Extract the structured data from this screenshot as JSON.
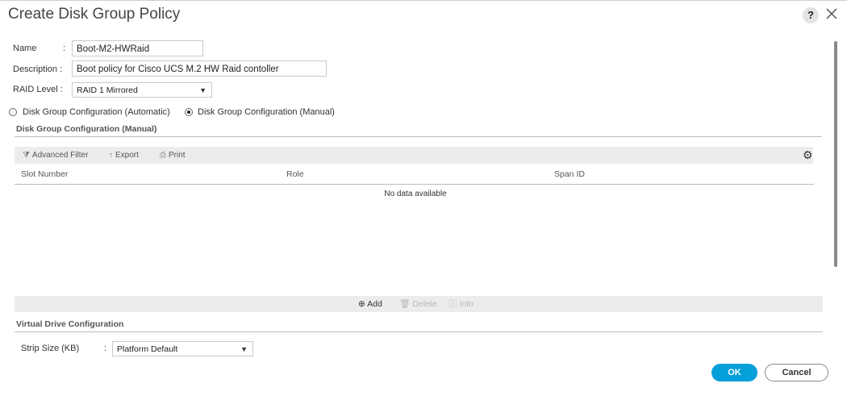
{
  "dialog": {
    "title": "Create Disk Group Policy",
    "help_glyph": "?"
  },
  "form": {
    "name_label": "Name",
    "name_colon": ":",
    "name_value": "Boot-M2-HWRaid",
    "description_label": "Description :",
    "description_value": "Boot policy for Cisco UCS M.2 HW Raid contoller",
    "raid_label": "RAID Level :",
    "raid_value": "RAID 1 Mirrored",
    "config_auto_label": "Disk Group Configuration (Automatic)",
    "config_manual_label": "Disk Group Configuration (Manual)",
    "config_selected": "manual"
  },
  "manual_section": {
    "title": "Disk Group Configuration (Manual)",
    "toolbar": {
      "filter_label": "Advanced Filter",
      "export_label": "Export",
      "print_label": "Print"
    },
    "columns": [
      "Slot Number",
      "Role",
      "Span ID"
    ],
    "empty_message": "No data available",
    "actions": {
      "add_label": "Add",
      "delete_label": "Delete",
      "info_label": "Info"
    }
  },
  "virtual_drive": {
    "title": "Virtual Drive Configuration",
    "strip_label": "Strip Size (KB)",
    "strip_colon": ":",
    "strip_value": "Platform Default"
  },
  "buttons": {
    "ok_label": "OK",
    "cancel_label": "Cancel"
  },
  "colors": {
    "primary": "#049fd9",
    "disabled": "#b8b8b8",
    "toolbar_bg": "#ececec"
  },
  "icons": [
    "help-icon",
    "close-icon",
    "filter-icon",
    "export-icon",
    "print-icon",
    "gear-icon",
    "add-icon",
    "delete-icon",
    "info-icon",
    "chevron-down-icon"
  ]
}
